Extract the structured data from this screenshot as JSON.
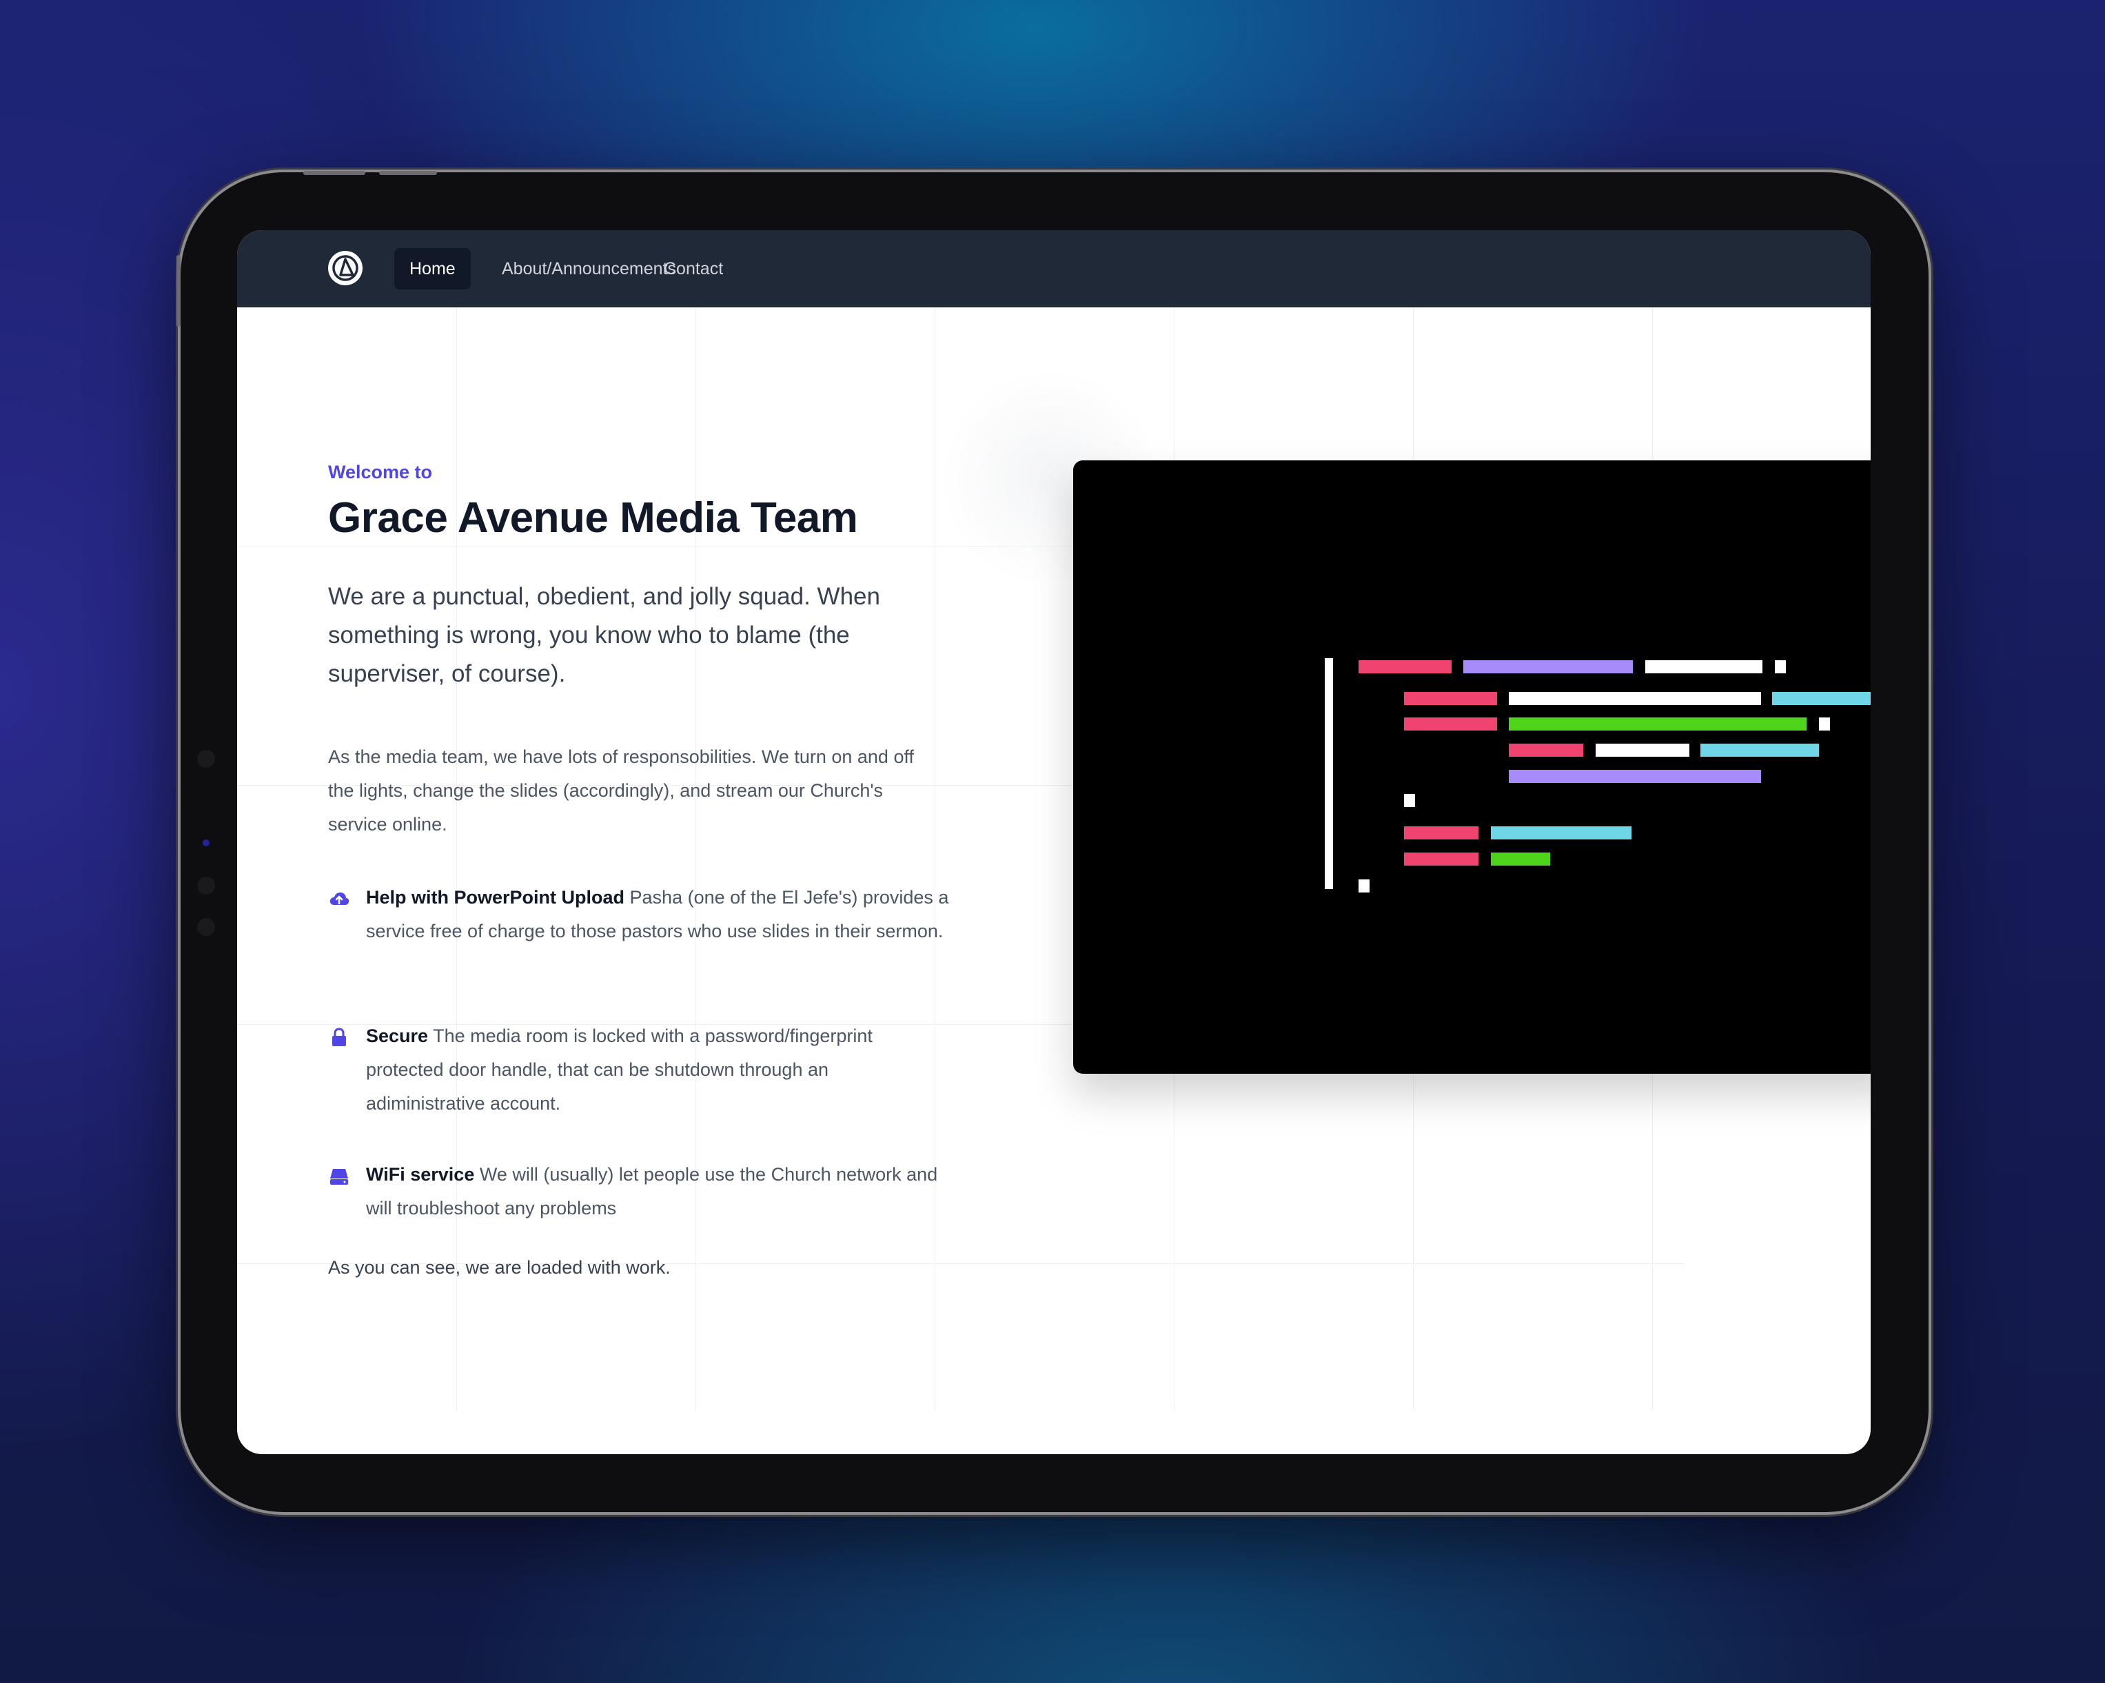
{
  "nav": {
    "logo_icon": "logo-icon",
    "items": [
      {
        "label": "Home",
        "active": true
      },
      {
        "label": "About/Announcements",
        "active": false
      },
      {
        "label": "Contact",
        "active": false
      }
    ]
  },
  "hero": {
    "eyebrow": "Welcome to",
    "title": "Grace Avenue Media Team",
    "lead": "We are a punctual, obedient, and jolly squad. When something is wrong, you know who to blame (the superviser, of course).",
    "body": "As the media team, we have lots of responsobilities. We turn on and off the lights, change the slides (accordingly), and stream our Church's service online.",
    "features": [
      {
        "icon": "cloud-upload-icon",
        "title": "Help with PowerPoint Upload",
        "text": "Pasha (one of the El Jefe's) provides a service free of charge to those pastors who use slides in their sermon."
      },
      {
        "icon": "lock-icon",
        "title": "Secure",
        "text": "The media room is locked with a password/fingerprint protected door handle, that can be shutdown through an adiministrative account."
      },
      {
        "icon": "server-icon",
        "title": "WiFi service",
        "text": "We will (usually) let people use the Church network and will troubleshoot any problems"
      }
    ],
    "outro": "As you can see, we are loaded with work."
  },
  "colors": {
    "accent": "#4f46e5",
    "nav_bg": "#1f2937",
    "code_pink": "#f0436f",
    "code_purple": "#a78bfa",
    "code_white": "#ffffff",
    "code_cyan": "#6fd6e8",
    "code_green": "#4fd41c"
  }
}
